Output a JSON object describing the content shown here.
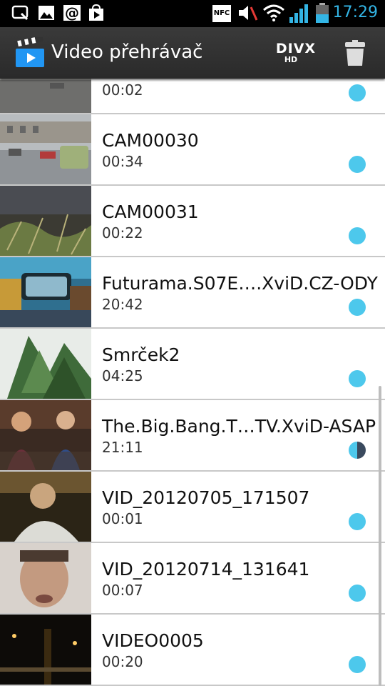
{
  "status_bar": {
    "time": "17:29",
    "icons": [
      "nfc-icon",
      "mute-icon",
      "wifi-icon",
      "signal-icon",
      "battery-icon"
    ],
    "nfc_label": "NFC"
  },
  "action_bar": {
    "title": "Video přehrávač",
    "divx_label": "DIVX",
    "divx_sub": "HD"
  },
  "videos": [
    {
      "title": "",
      "duration": "00:02"
    },
    {
      "title": "CAM00030",
      "duration": "00:34"
    },
    {
      "title": "CAM00031",
      "duration": "00:22"
    },
    {
      "title": "Futurama.S07E….XviD.CZ-ODY",
      "duration": "20:42"
    },
    {
      "title": "Smrček2",
      "duration": "04:25"
    },
    {
      "title": "The.Big.Bang.T…TV.XviD-ASAP",
      "duration": "21:11",
      "partially_watched": true
    },
    {
      "title": "VID_20120705_171507",
      "duration": "00:01"
    },
    {
      "title": "VID_20120714_131641",
      "duration": "00:07"
    },
    {
      "title": "VIDEO0005",
      "duration": "00:20"
    }
  ],
  "colors": {
    "accent": "#33b5e5",
    "dot": "#4dc8ec"
  }
}
